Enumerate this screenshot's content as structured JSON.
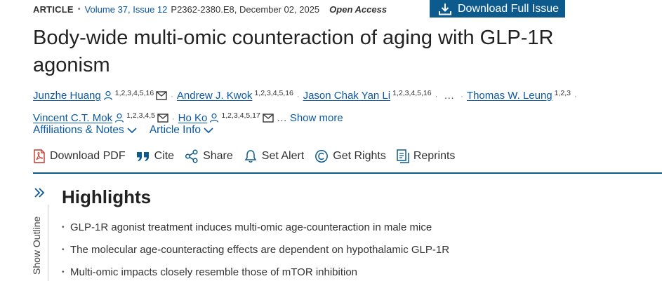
{
  "meta": {
    "type": "ARTICLE",
    "volume": "Volume 37, Issue 12",
    "pages_date": "P2362-2380.E8, December 02, 2025",
    "open_access": "Open Access",
    "download_issue": "Download Full Issue"
  },
  "title": "Body-wide multi-omic counteraction of aging with GLP-1R agonism",
  "authors": [
    {
      "name": "Junzhe Huang",
      "affil": "1,2,3,4,5,16"
    },
    {
      "name": "Andrew J. Kwok",
      "affil": "1,2,3,4,5,16"
    },
    {
      "name": "Jason Chak Yan Li",
      "affil": "1,2,3,4,5,16"
    },
    {
      "name": "Thomas W. Leung",
      "affil": "1,2,3"
    },
    {
      "name": "Vincent C.T. Mok",
      "affil": "1,2,3,4,5"
    },
    {
      "name": "Ho Ko",
      "affil": "1,2,3,4,5,17"
    }
  ],
  "ellipsis": "…",
  "show_more": "Show more",
  "sublinks": {
    "affiliations": "Affiliations & Notes",
    "article_info": "Article Info"
  },
  "toolbar": {
    "download_pdf": "Download PDF",
    "cite": "Cite",
    "share": "Share",
    "set_alert": "Set Alert",
    "get_rights": "Get Rights",
    "reprints": "Reprints"
  },
  "outline": {
    "label": "Show Outline"
  },
  "highlights": {
    "heading": "Highlights",
    "items": [
      "GLP-1R agonist treatment induces multi-omic age-counteraction in male mice",
      "The molecular age-counteracting effects are dependent on hypothalamic GLP-1R",
      "Multi-omic impacts closely resemble those of mTOR inhibition"
    ]
  },
  "colors": {
    "accent": "#0d5b8c",
    "link": "#0a58a3",
    "pdf_red": "#c0392b"
  }
}
